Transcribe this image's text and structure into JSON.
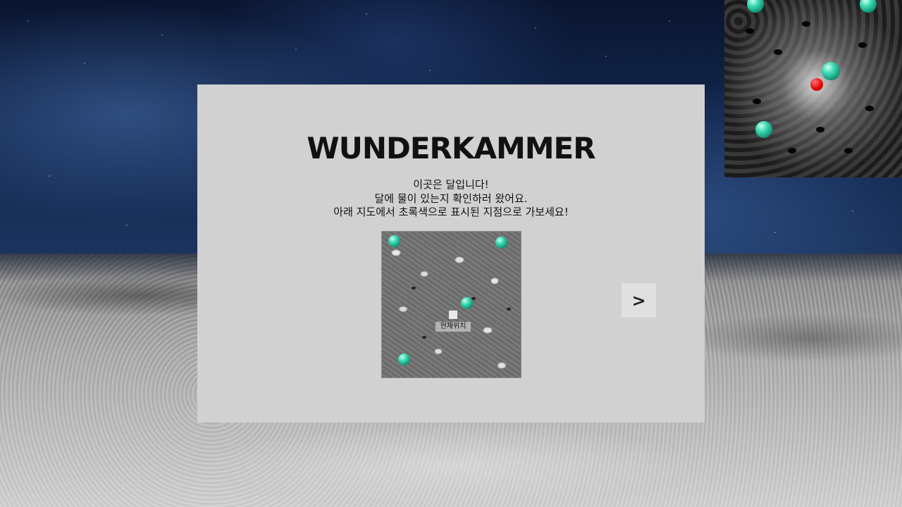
{
  "game": {
    "title": "WUNDERKAMMER",
    "intro_lines": [
      "이곳은 달입니다!",
      "달에 물이 있는지 확인하러 왔어요.",
      "아래 지도에서 초록색으로 표시된 지점으로 가보세요!"
    ],
    "map": {
      "current_location_label": "현재위치"
    },
    "next_button_label": ">"
  },
  "colors": {
    "panel_background": "#d1d1d1",
    "target_marker": "#39d9b1",
    "player_marker": "#e00000"
  },
  "icons": {
    "target": "green-orb-icon",
    "player": "red-dot-icon",
    "current_position": "square-marker-icon"
  }
}
